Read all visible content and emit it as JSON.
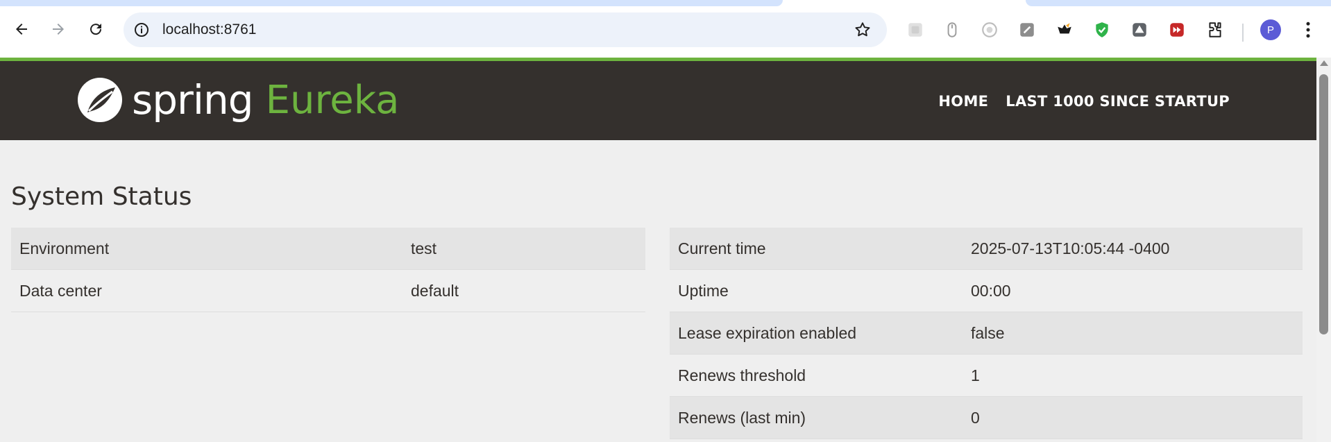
{
  "browser": {
    "url": "localhost:8761",
    "avatar_letter": "P"
  },
  "header": {
    "brand": "spring",
    "product": "Eureka",
    "nav": [
      "HOME",
      "LAST 1000 SINCE STARTUP"
    ]
  },
  "section_title": "System Status",
  "left_table": [
    {
      "key": "Environment",
      "value": "test"
    },
    {
      "key": "Data center",
      "value": "default"
    }
  ],
  "right_table": [
    {
      "key": "Current time",
      "value": "2025-07-13T10:05:44 -0400"
    },
    {
      "key": "Uptime",
      "value": "00:00"
    },
    {
      "key": "Lease expiration enabled",
      "value": "false"
    },
    {
      "key": "Renews threshold",
      "value": "1"
    },
    {
      "key": "Renews (last min)",
      "value": "0"
    }
  ],
  "colors": {
    "header_bg": "#34302d",
    "accent_green": "#6db33f",
    "page_bg": "#efefef",
    "row_alt": "#e4e4e4"
  }
}
